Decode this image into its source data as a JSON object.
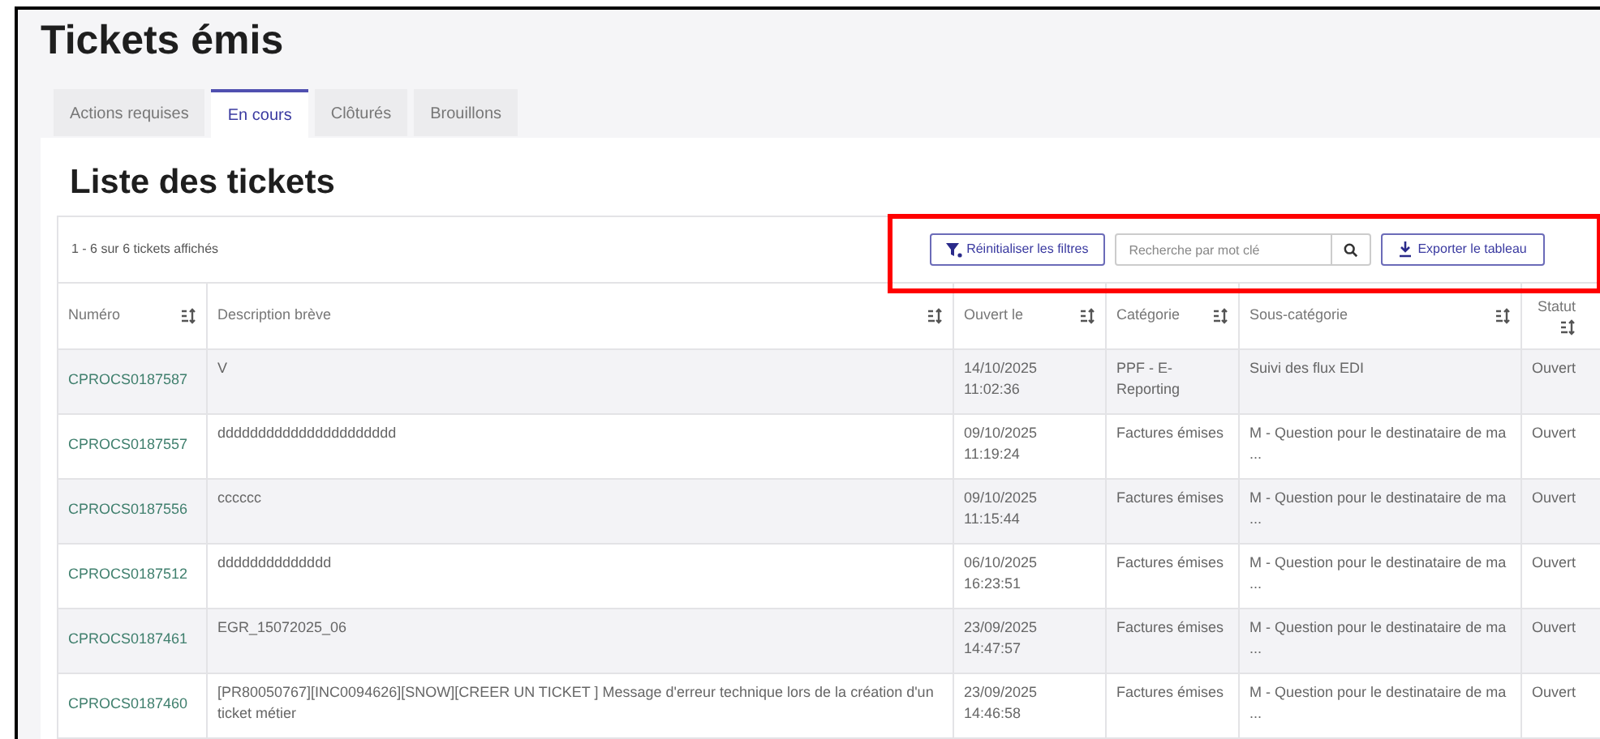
{
  "page_title": "Tickets émis",
  "tabs": [
    {
      "label": "Actions requises",
      "selected": false
    },
    {
      "label": "En cours",
      "selected": true
    },
    {
      "label": "Clôturés",
      "selected": false
    },
    {
      "label": "Brouillons",
      "selected": false
    }
  ],
  "section_title": "Liste des tickets",
  "result_count": "1 - 6 sur 6 tickets affichés",
  "reset_button": "Réinitialiser les filtres",
  "search": {
    "placeholder": "Recherche par mot clé"
  },
  "export_button": "Exporter le tableau",
  "highlighted": true,
  "table": {
    "columns": [
      {
        "label": "Numéro",
        "sortable": true
      },
      {
        "label": "Description brève",
        "sortable": true
      },
      {
        "label": "Ouvert le",
        "sortable": true
      },
      {
        "label": "Catégorie",
        "sortable": true
      },
      {
        "label": "Sous-catégorie",
        "sortable": true
      },
      {
        "label": "Statut",
        "sortable": true
      }
    ],
    "rows": [
      {
        "number": "CPROCS0187587",
        "description": "V",
        "opened": "14/10/2025 11:02:36",
        "category": "PPF - E-Reporting",
        "subcategory": "Suivi des flux EDI",
        "status": "Ouvert"
      },
      {
        "number": "CPROCS0187557",
        "description": "dddddddddddddddddddddd",
        "opened": "09/10/2025 11:19:24",
        "category": "Factures émises",
        "subcategory": "M - Question pour le destinataire de ma ...",
        "status": "Ouvert"
      },
      {
        "number": "CPROCS0187556",
        "description": "cccccc",
        "opened": "09/10/2025 11:15:44",
        "category": "Factures émises",
        "subcategory": "M - Question pour le destinataire de ma ...",
        "status": "Ouvert"
      },
      {
        "number": "CPROCS0187512",
        "description": "dddddddddddddd",
        "opened": "06/10/2025 16:23:51",
        "category": "Factures émises",
        "subcategory": "M - Question pour le destinataire de ma ...",
        "status": "Ouvert"
      },
      {
        "number": "CPROCS0187461",
        "description": "EGR_15072025_06",
        "opened": "23/09/2025 14:47:57",
        "category": "Factures émises",
        "subcategory": "M - Question pour le destinataire de ma ...",
        "status": "Ouvert"
      },
      {
        "number": "CPROCS0187460",
        "description": "[PR80050767][INC0094626][SNOW][CREER UN TICKET ] Message d'erreur technique lors de la création d'un ticket métier",
        "opened": "23/09/2025 14:46:58",
        "category": "Factures émises",
        "subcategory": "M - Question pour le destinataire de ma ...",
        "status": "Ouvert"
      }
    ]
  }
}
